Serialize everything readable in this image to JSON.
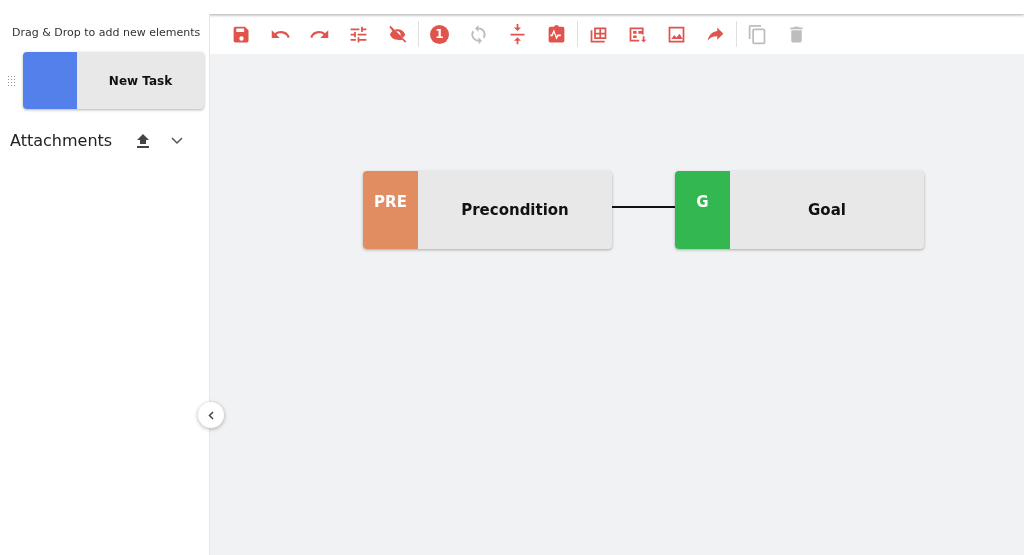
{
  "sidebar": {
    "hint": "Drag & Drop to add new elements",
    "palette": [
      {
        "label": "New Task",
        "color": "#5480ec"
      }
    ],
    "attachments": {
      "title": "Attachments",
      "expanded": false
    }
  },
  "toolbar": [
    {
      "kind": "save",
      "disabled": false
    },
    {
      "kind": "undo",
      "disabled": false
    },
    {
      "kind": "redo",
      "disabled": false
    },
    {
      "kind": "tune",
      "disabled": false
    },
    {
      "kind": "hide",
      "disabled": false,
      "divider": true
    },
    {
      "kind": "alert",
      "count": "1"
    },
    {
      "kind": "sync",
      "disabled": true
    },
    {
      "kind": "compress",
      "disabled": false
    },
    {
      "kind": "clipboard",
      "disabled": false,
      "divider": true
    },
    {
      "kind": "table",
      "disabled": false
    },
    {
      "kind": "table-add",
      "disabled": false
    },
    {
      "kind": "image",
      "disabled": false
    },
    {
      "kind": "forward",
      "disabled": false,
      "divider": true
    },
    {
      "kind": "copy",
      "disabled": true
    },
    {
      "kind": "delete",
      "disabled": true
    }
  ],
  "canvas": {
    "nodes": [
      {
        "tag": "PRE",
        "label": "Precondition",
        "color": "#e28c62"
      },
      {
        "tag": "G",
        "label": "Goal",
        "color": "#33b751"
      }
    ]
  }
}
